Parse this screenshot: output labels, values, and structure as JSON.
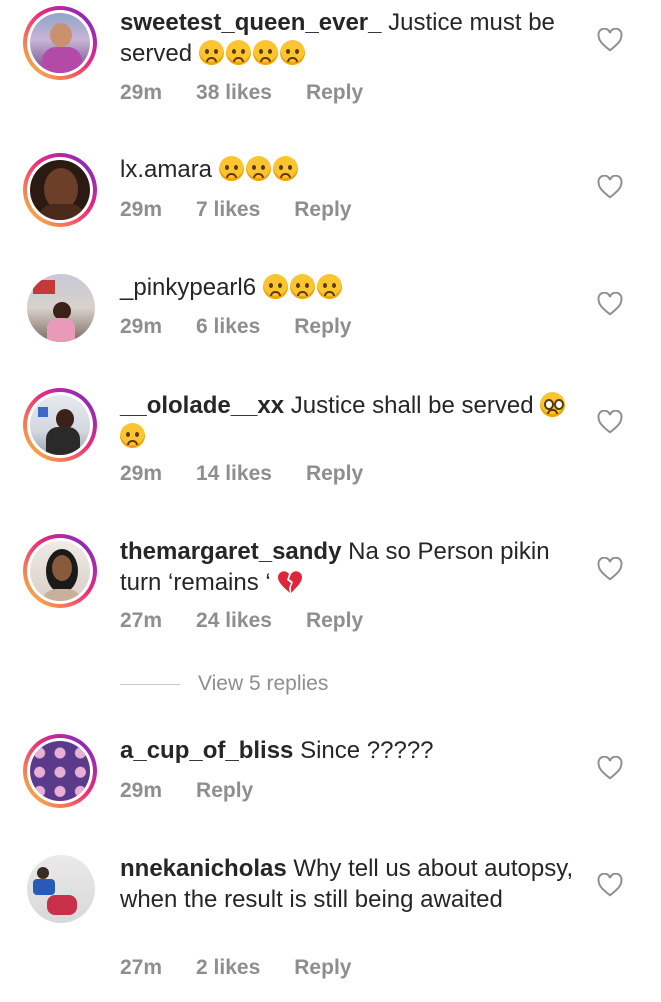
{
  "comments": [
    {
      "username": "sweetest_queen_ever_",
      "text": " Justice must be served ",
      "emojis": [
        "crying",
        "crying",
        "crying",
        "crying"
      ],
      "time": "29m",
      "likes": "38 likes",
      "reply": "Reply",
      "avatar_ring": true
    },
    {
      "username": "lx.amara",
      "text": " ",
      "emojis": [
        "crying",
        "crying",
        "crying"
      ],
      "time": "29m",
      "likes": "7 likes",
      "reply": "Reply",
      "avatar_ring": true
    },
    {
      "username": "_pinkypearl6",
      "text": " ",
      "emojis": [
        "crying",
        "crying",
        "crying"
      ],
      "time": "29m",
      "likes": "6 likes",
      "reply": "Reply",
      "avatar_ring": false
    },
    {
      "username": "__ololade__xx",
      "text": " Justice shall be served ",
      "emojis": [
        "pleading",
        "crying"
      ],
      "time": "29m",
      "likes": "14 likes",
      "reply": "Reply",
      "avatar_ring": true
    },
    {
      "username": "themargaret_sandy",
      "text": " Na so Person pikin turn ‘remains ‘ ",
      "emojis": [
        "broken-heart"
      ],
      "time": "27m",
      "likes": "24 likes",
      "reply": "Reply",
      "avatar_ring": true
    },
    {
      "username": "a_cup_of_bliss",
      "text": " Since ?????",
      "emojis": [],
      "time": "29m",
      "likes": "",
      "reply": "Reply",
      "avatar_ring": true
    },
    {
      "username": "nnekanicholas",
      "text": " Why tell us about autopsy, when the result is still being awaited",
      "emojis": [],
      "time": "27m",
      "likes": "2 likes",
      "reply": "Reply",
      "avatar_ring": false
    }
  ],
  "view_replies": "View 5 replies",
  "colors": {
    "text": "#262626",
    "meta": "#8e8e8e",
    "ring_start": "#f9ce34",
    "ring_end": "#6228d7"
  },
  "icons": {
    "like": "heart-outline-icon"
  }
}
